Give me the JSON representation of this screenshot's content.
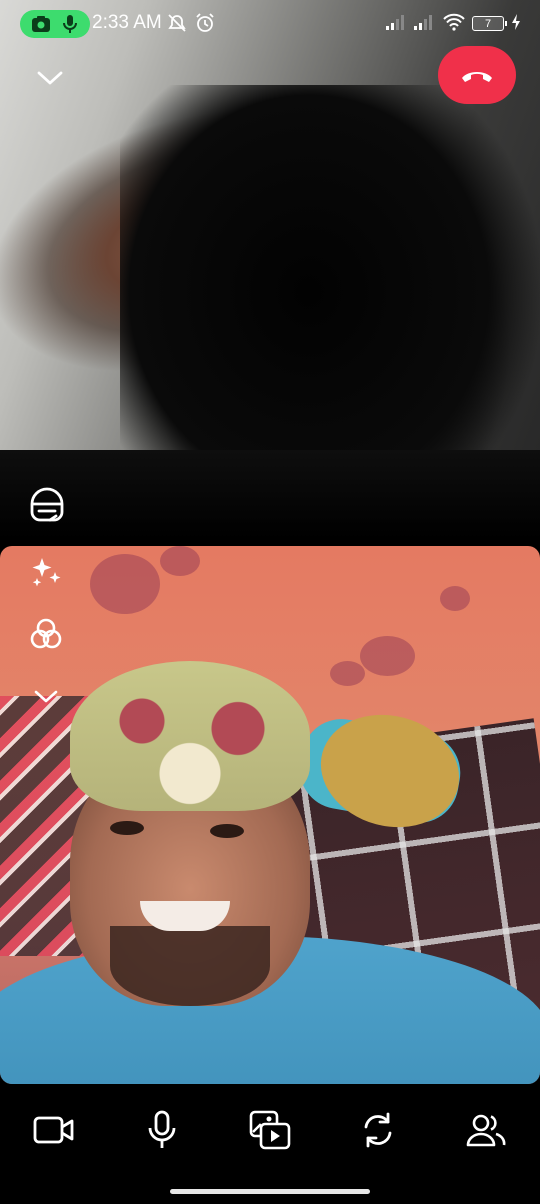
{
  "status_bar": {
    "time": "2:33 AM",
    "battery_level": "7",
    "icons": [
      "camera-icon",
      "microphone-icon",
      "mute-icon",
      "alarm-icon",
      "signal-icon",
      "signal-icon",
      "wifi-icon",
      "battery-icon",
      "charging-icon"
    ],
    "rec_pill_color": "#3ddc6e"
  },
  "call": {
    "end_call_color": "#f0304a",
    "top_controls": [
      "chevron-down-icon",
      "end-call-icon",
      "effects-icon"
    ],
    "side_tools": [
      "sparkles-icon",
      "filter-icon",
      "chevron-down-icon"
    ]
  },
  "toolbar": {
    "buttons": [
      "video-camera-icon",
      "microphone-icon",
      "media-share-icon",
      "switch-camera-icon",
      "people-icon"
    ]
  }
}
